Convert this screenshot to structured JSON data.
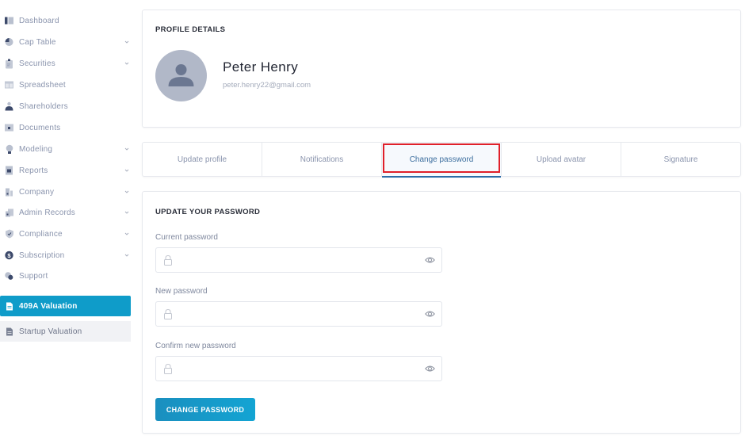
{
  "sidebar": {
    "items": [
      {
        "label": "Dashboard",
        "icon": "dashboard-icon",
        "has_chevron": false
      },
      {
        "label": "Cap Table",
        "icon": "pie-chart-icon",
        "has_chevron": true
      },
      {
        "label": "Securities",
        "icon": "clipboard-icon",
        "has_chevron": true
      },
      {
        "label": "Spreadsheet",
        "icon": "spreadsheet-icon",
        "has_chevron": false
      },
      {
        "label": "Shareholders",
        "icon": "user-icon",
        "has_chevron": false
      },
      {
        "label": "Documents",
        "icon": "folder-icon",
        "has_chevron": false
      },
      {
        "label": "Modeling",
        "icon": "lightbulb-icon",
        "has_chevron": true
      },
      {
        "label": "Reports",
        "icon": "report-icon",
        "has_chevron": true
      },
      {
        "label": "Company",
        "icon": "building-icon",
        "has_chevron": true
      },
      {
        "label": "Admin Records",
        "icon": "records-icon",
        "has_chevron": true
      },
      {
        "label": "Compliance",
        "icon": "shield-check-icon",
        "has_chevron": true
      },
      {
        "label": "Subscription",
        "icon": "dollar-circle-icon",
        "has_chevron": true
      },
      {
        "label": "Support",
        "icon": "chat-icon",
        "has_chevron": false
      }
    ],
    "valuation_items": [
      {
        "label": "409A Valuation",
        "icon": "document-icon",
        "active": true
      },
      {
        "label": "Startup Valuation",
        "icon": "document-icon",
        "active": false
      }
    ]
  },
  "profile": {
    "section_title": "PROFILE DETAILS",
    "name": "Peter Henry",
    "email": "peter.henry22@gmail.com"
  },
  "tabs": [
    {
      "label": "Update profile",
      "active": false
    },
    {
      "label": "Notifications",
      "active": false
    },
    {
      "label": "Change password",
      "active": true
    },
    {
      "label": "Upload avatar",
      "active": false
    },
    {
      "label": "Signature",
      "active": false
    }
  ],
  "password_form": {
    "section_title": "UPDATE YOUR PASSWORD",
    "fields": [
      {
        "label": "Current password",
        "value": "",
        "placeholder": ""
      },
      {
        "label": "New password",
        "value": "",
        "placeholder": ""
      },
      {
        "label": "Confirm new password",
        "value": "",
        "placeholder": ""
      }
    ],
    "submit_label": "CHANGE PASSWORD"
  },
  "colors": {
    "accent": "#0f9cc9",
    "active_tab_text": "#3c6e9e",
    "tab_underline": "#2d6da8",
    "highlight_box": "#e0202a",
    "muted_text": "#8a94ad"
  }
}
